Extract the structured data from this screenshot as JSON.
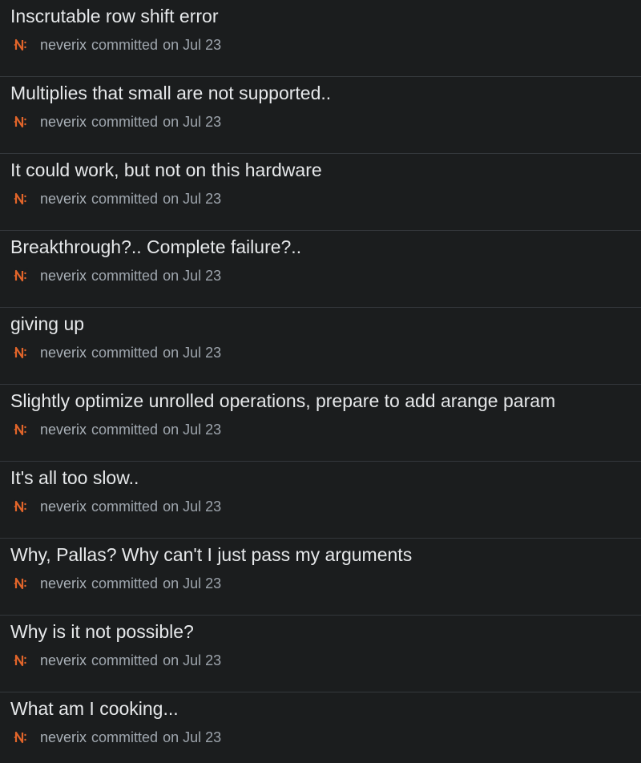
{
  "colors": {
    "background": "#1b1d1e",
    "divider": "#34383c",
    "title": "#e6e8ea",
    "meta": "#9ea5ad",
    "avatar_accent": "#e2652a"
  },
  "icons": {
    "avatar": "neverix-avatar-icon"
  },
  "commits": [
    {
      "title": "Inscrutable row shift error",
      "author": "neverix",
      "action": "committed",
      "date": "on Jul 23"
    },
    {
      "title": "Multiplies that small are not supported..",
      "author": "neverix",
      "action": "committed",
      "date": "on Jul 23"
    },
    {
      "title": "It could work, but not on this hardware",
      "author": "neverix",
      "action": "committed",
      "date": "on Jul 23"
    },
    {
      "title": "Breakthrough?.. Complete failure?..",
      "author": "neverix",
      "action": "committed",
      "date": "on Jul 23"
    },
    {
      "title": "giving up",
      "author": "neverix",
      "action": "committed",
      "date": "on Jul 23"
    },
    {
      "title": "Slightly optimize unrolled operations, prepare to add arange param",
      "author": "neverix",
      "action": "committed",
      "date": "on Jul 23"
    },
    {
      "title": "It's all too slow..",
      "author": "neverix",
      "action": "committed",
      "date": "on Jul 23"
    },
    {
      "title": "Why, Pallas? Why can't I just pass my arguments",
      "author": "neverix",
      "action": "committed",
      "date": "on Jul 23"
    },
    {
      "title": "Why is it not possible?",
      "author": "neverix",
      "action": "committed",
      "date": "on Jul 23"
    },
    {
      "title": "What am I cooking...",
      "author": "neverix",
      "action": "committed",
      "date": "on Jul 23"
    }
  ]
}
